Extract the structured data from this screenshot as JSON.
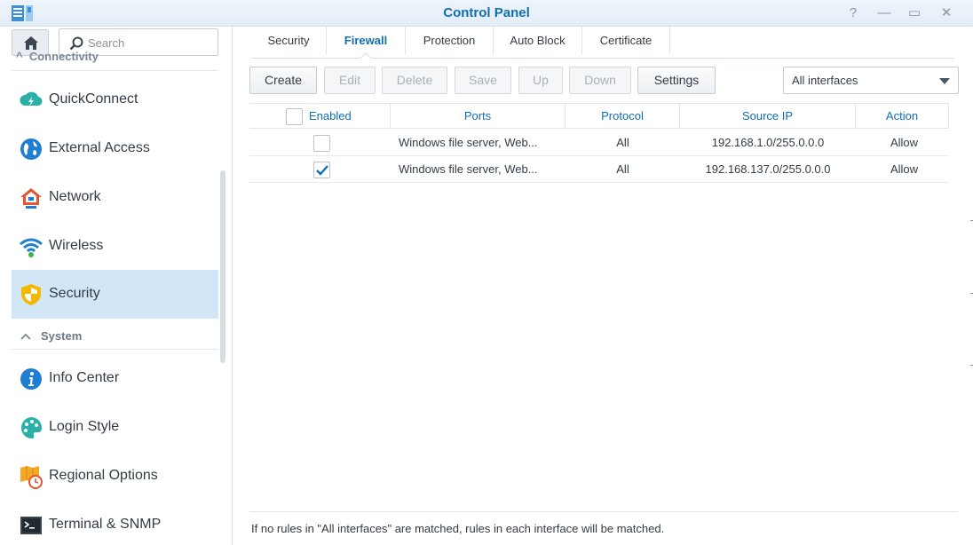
{
  "window": {
    "title": "Control Panel",
    "controls": {
      "help": "?",
      "minimize": "—",
      "maximize": "▭",
      "close": "✕"
    }
  },
  "sidebar": {
    "search_placeholder": "Search",
    "partial_header": "Connectivity",
    "items_top": [
      {
        "label": "QuickConnect",
        "icon": "quickconnect-icon"
      },
      {
        "label": "External Access",
        "icon": "globe-icon"
      },
      {
        "label": "Network",
        "icon": "house-network-icon"
      },
      {
        "label": "Wireless",
        "icon": "wifi-icon"
      },
      {
        "label": "Security",
        "icon": "shield-icon",
        "active": true
      }
    ],
    "group_header": "System",
    "items_system": [
      {
        "label": "Info Center",
        "icon": "info-icon"
      },
      {
        "label": "Login Style",
        "icon": "palette-icon"
      },
      {
        "label": "Regional Options",
        "icon": "clock-map-icon"
      },
      {
        "label": "Terminal & SNMP",
        "icon": "terminal-icon"
      }
    ]
  },
  "tabs": [
    {
      "label": "Security"
    },
    {
      "label": "Firewall",
      "active": true
    },
    {
      "label": "Protection"
    },
    {
      "label": "Auto Block"
    },
    {
      "label": "Certificate"
    }
  ],
  "toolbar": {
    "create": "Create",
    "edit": "Edit",
    "delete": "Delete",
    "save": "Save",
    "up": "Up",
    "down": "Down",
    "settings": "Settings",
    "interface_select": "All interfaces"
  },
  "table": {
    "columns": [
      "Enabled",
      "Ports",
      "Protocol",
      "Source IP",
      "Action"
    ],
    "rows": [
      {
        "enabled": false,
        "ports": "Windows file server, Web...",
        "protocol": "All",
        "source_ip": "192.168.1.0/255.0.0.0",
        "action": "Allow"
      },
      {
        "enabled": true,
        "ports": "Windows file server, Web...",
        "protocol": "All",
        "source_ip": "192.168.137.0/255.0.0.0",
        "action": "Allow"
      }
    ]
  },
  "footer": {
    "note": "If no rules in \"All interfaces\" are matched, rules in each interface will be matched."
  },
  "colors": {
    "accent": "#0f6fb4",
    "active_bg": "#d1e6f6"
  }
}
